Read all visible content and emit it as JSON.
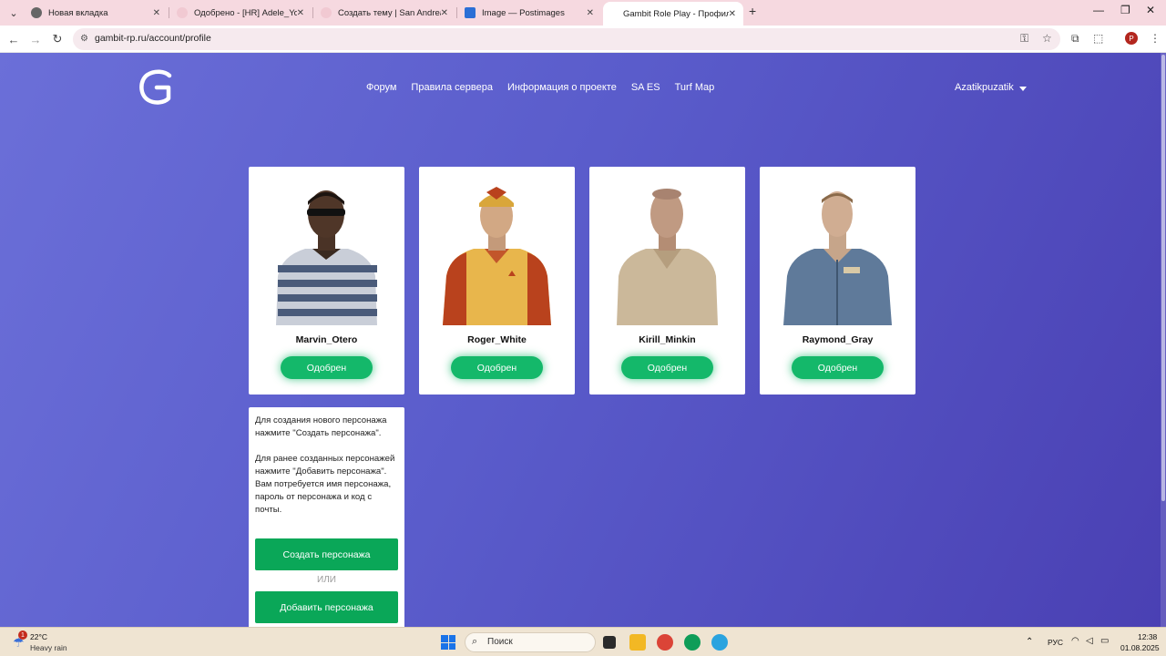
{
  "browser": {
    "tabs": [
      {
        "title": "Новая вкладка",
        "active": false
      },
      {
        "title": "Одобрено - [HR] Adele_Young",
        "active": false
      },
      {
        "title": "Создать тему | San Andreas Em",
        "active": false
      },
      {
        "title": "Image — Postimages",
        "active": false
      },
      {
        "title": "Gambit Role Play - Профиль Ul",
        "active": true
      }
    ],
    "url": "gambit-rp.ru/account/profile",
    "profile_initial": "P"
  },
  "site": {
    "nav": [
      "Форум",
      "Правила сервера",
      "Информация о проекте",
      "SA ES",
      "Turf Map"
    ],
    "username": "Azatikpuzatik",
    "characters": [
      {
        "name": "Marvin_Otero",
        "status": "Одобрен"
      },
      {
        "name": "Roger_White",
        "status": "Одобрен"
      },
      {
        "name": "Kirill_Minkin",
        "status": "Одобрен"
      },
      {
        "name": "Raymond_Gray",
        "status": "Одобрен"
      }
    ],
    "info": {
      "create_hint": "Для создания нового персонажа нажмите \"Создать персонажа\".",
      "add_hint": "Для ранее созданных персонажей нажмите \"Добавить персонажа\". Вам потребуется имя персонажа, пароль от персонажа и код с почты.",
      "create_label": "Создать персонажа",
      "or_label": "ИЛИ",
      "add_label": "Добавить персонажа"
    }
  },
  "taskbar": {
    "weather_temp": "22°C",
    "weather_desc": "Heavy rain",
    "weather_badge": "1",
    "search_label": "Поиск",
    "language": "РУС",
    "time": "12:38",
    "date": "01.08.2025"
  },
  "colors": {
    "page_gradient_start": "#6b6fd8",
    "page_gradient_end": "#4a40b3",
    "approved_green": "#14b86a",
    "button_green": "#0aa758",
    "tabbar": "#f6d9e0"
  }
}
